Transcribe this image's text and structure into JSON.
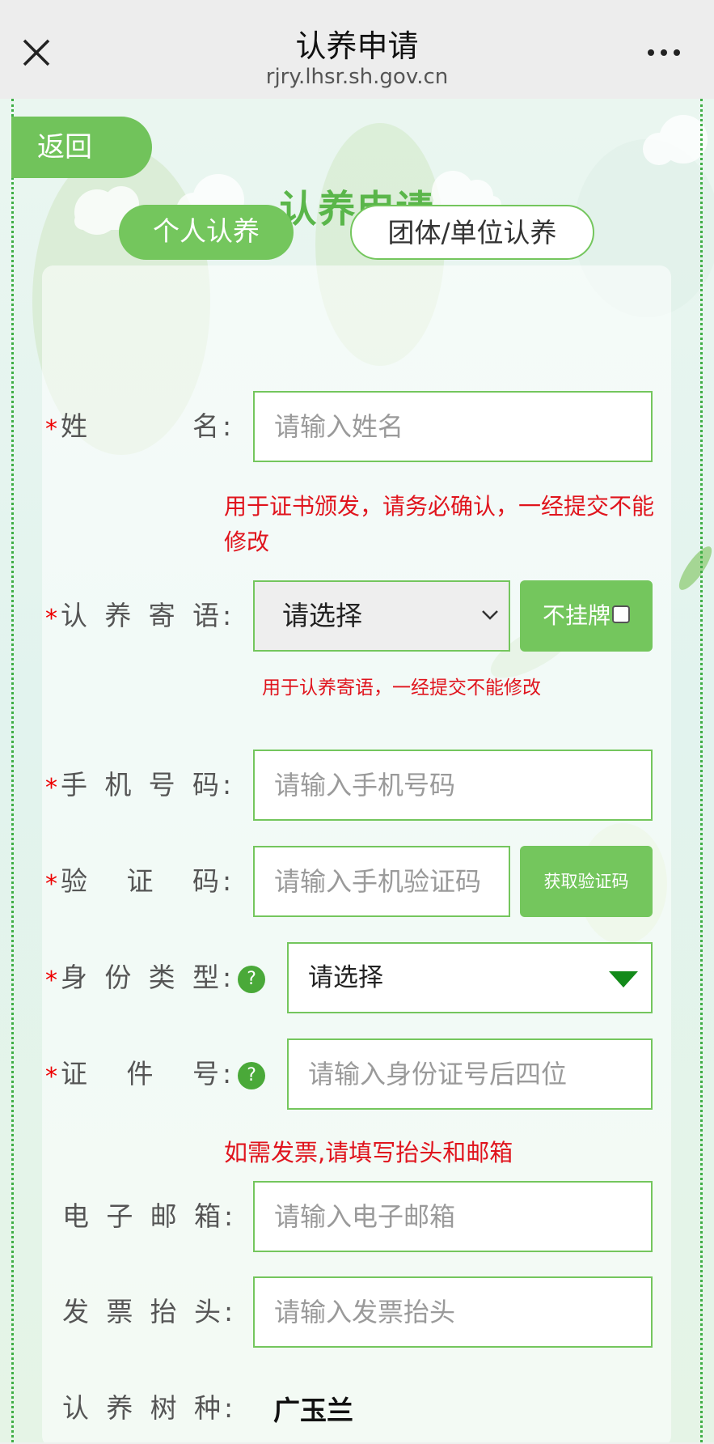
{
  "topbar": {
    "title": "认养申请",
    "domain": "rjry.lhsr.sh.gov.cn"
  },
  "page": {
    "back_label": "返回",
    "title": "认养申请"
  },
  "tabs": [
    {
      "label": "个人认养",
      "active": true
    },
    {
      "label": "团体/单位认养",
      "active": false
    }
  ],
  "form": {
    "name": {
      "label": "姓名",
      "placeholder": "请输入姓名",
      "note": "用于证书颁发，请务必确认，一经提交不能修改"
    },
    "message": {
      "label": "认养寄语",
      "select_value": "请选择",
      "no_sign_label": "不挂牌",
      "note": "用于认养寄语，一经提交不能修改"
    },
    "phone": {
      "label": "手机号码",
      "placeholder": "请输入手机号码"
    },
    "code": {
      "label": "验证码",
      "placeholder": "请输入手机验证码",
      "button": "获取验证码"
    },
    "id_type": {
      "label": "身份类型",
      "help": "?",
      "select_value": "请选择"
    },
    "id_number": {
      "label": "证件号",
      "help": "?",
      "placeholder": "请输入身份证号后四位"
    },
    "invoice_note": "如需发票,请填写抬头和邮箱",
    "email": {
      "label": "电子邮箱",
      "placeholder": "请输入电子邮箱"
    },
    "invoice_title": {
      "label": "发票抬头",
      "placeholder": "请输入发票抬头"
    },
    "tree": {
      "label": "认养树种",
      "value": "广玉兰"
    }
  },
  "colors": {
    "accent": "#74c65d",
    "title_green": "#5ab64a",
    "required_red": "#e00000",
    "note_red": "#e0141d"
  }
}
